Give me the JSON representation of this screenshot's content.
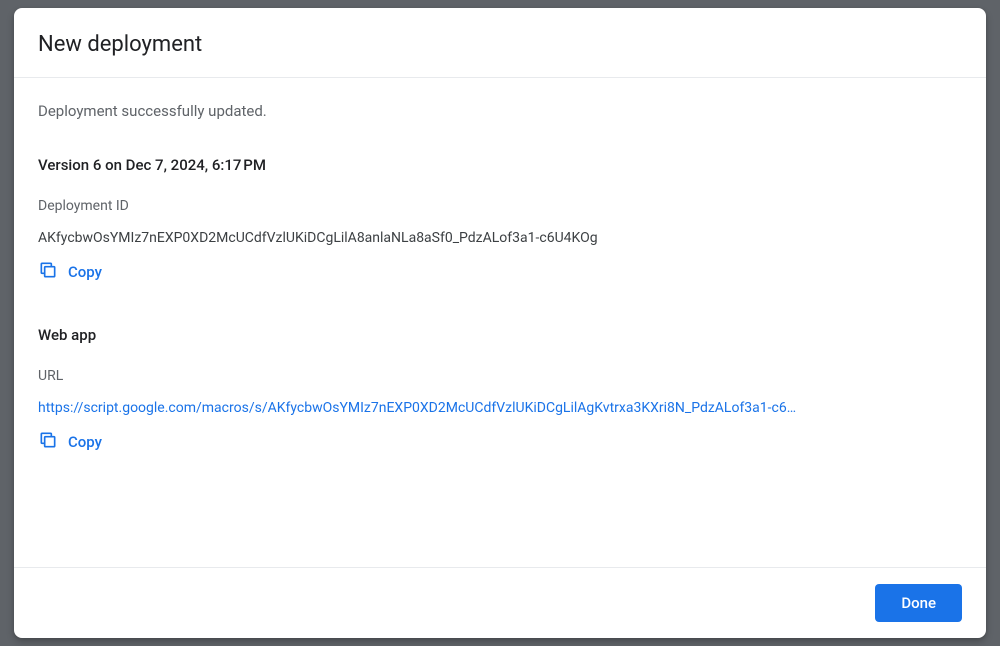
{
  "modal": {
    "title": "New deployment",
    "status_message": "Deployment successfully updated.",
    "version_heading": "Version 6 on Dec 7, 2024, 6:17 PM",
    "deployment_id_label": "Deployment ID",
    "deployment_id_value": "AKfycbwOsYMIz7nEXP0XD2McUCdfVzlUKiDCgLilA8anlaNLa8aSf0_PdzALof3a1-c6U4KOg",
    "copy_label": "Copy",
    "web_app_heading": "Web app",
    "url_label": "URL",
    "url_value": "https://script.google.com/macros/s/AKfycbwOsYMIz7nEXP0XD2McUCdfVzlUKiDCgLilAgKvtrxa3KXri8N_PdzALof3a1-c6…",
    "done_label": "Done"
  }
}
